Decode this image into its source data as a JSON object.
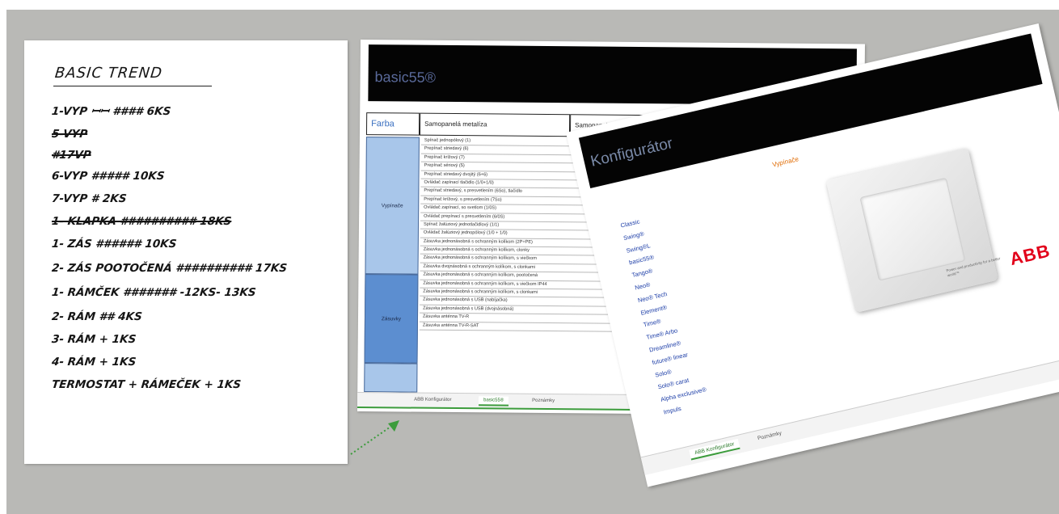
{
  "note": {
    "title": "BASIC TREND",
    "lines": [
      {
        "text": "1-VYP   ꟷꟷ  ####  6KS",
        "struck": false
      },
      {
        "text": "5-VYP",
        "struck": true
      },
      {
        "text": "#17VP",
        "struck": true
      },
      {
        "text": "6-VYP   #####  10KS",
        "struck": false
      },
      {
        "text": "7-VYP   #       2KS",
        "struck": false
      },
      {
        "text": "1- KLAPKA  ##########  18KS",
        "struck": true
      },
      {
        "text": "1- ZÁS   ######  10KS",
        "struck": false
      },
      {
        "text": "2- ZÁS  POOTOČENÁ  ##########  17KS",
        "struck": false
      },
      {
        "text": "1- RÁMČEK  #######  -12KS-  13KS",
        "struck": false
      },
      {
        "text": "2- RÁM       ##  4KS",
        "struck": false
      },
      {
        "text": "3- RÁM        +  1KS",
        "struck": false
      },
      {
        "text": "4- RÁM        +  1KS",
        "struck": false
      },
      {
        "text": "TERMOSTAT + RÁMEČEK + 1KS",
        "struck": false
      }
    ]
  },
  "sheet": {
    "title": "basic55®",
    "headers": [
      "Farba",
      "Samopanelá metalíza",
      "Samopanelá metalíza"
    ],
    "groups": [
      "Vypínače",
      "Zásuvky",
      ""
    ],
    "rows": [
      "Spínač jednopólový (1)",
      "Prepínač striedavý (6)",
      "Prepínač krížový (7)",
      "Prepínač sériový (5)",
      "Prepínač striedavý dvojitý (6+6)",
      "Ovládač zapínací tlačidlo (1/0+1/0)",
      "Prepínač striedavý, s presvetlením (6So), tlačidlo",
      "Prepínač krížový, s presvetlením (7So)",
      "Ovládač zapínací, so svetlom (1/0S)",
      "Ovládač prepínací s presvetlením (6/0S)",
      "Spínač žalúziový jednotlačidlový (1/1)",
      "Ovládač žalúziový jednopólový (1/0 + 1/0)",
      "Zásuvka jednonásobná s ochranným kolíkom (2P+PE)",
      "Zásuvka jednonásobná s ochranným kolíkom, clonky",
      "Zásuvka jednonásobná s ochranným kolíkom, s viečkom",
      "Zásuvka dvojnásobná s ochranným kolíkom, s clonkami",
      "Zásuvka jednonásobná s ochranným kolíkom, pootočená",
      "Zásuvka jednonásobná s ochranným kolíkom, s viečkom IP44",
      "Zásuvka jednonásobná s ochranným kolíkom, s clonkami",
      "Zásuvka jednonásobná s USB (nabíjačka)",
      "Zásuvka jednonásobná s USB (dvojnásobná)",
      "Zásuvka anténna TV-R",
      "Zásuvka anténna TV-R-SAT"
    ],
    "tabs": [
      "ABB Konfigurátor",
      "basic55®",
      "Poznámky"
    ],
    "active_tab": 1
  },
  "konfigurator": {
    "title": "Konfigurátor",
    "subtitle": "Vypínače",
    "items": [
      "Classic",
      "Swing®",
      "Swing®L",
      "basic55®",
      "Tango®",
      "Neo®",
      "Neo® Tech",
      "Element®",
      "Time®",
      "Time® Arbo",
      "Dreamline®",
      "future® linear",
      "Solo®",
      "Solo® carat",
      "Alpha exclusive®",
      "Impuls"
    ],
    "brand": "ABB",
    "brand_note": "Power and productivity for a better world™",
    "tabs": [
      "ABB Konfigurátor",
      "Poznámky"
    ],
    "active_tab": 0
  },
  "colors": {
    "background": "#b9b9b6",
    "header_black": "#040404",
    "link_blue": "#1e3fa8",
    "abb_red": "#e2001a",
    "arrow_green": "#3c9c3c",
    "accent_orange": "#e06a00"
  }
}
